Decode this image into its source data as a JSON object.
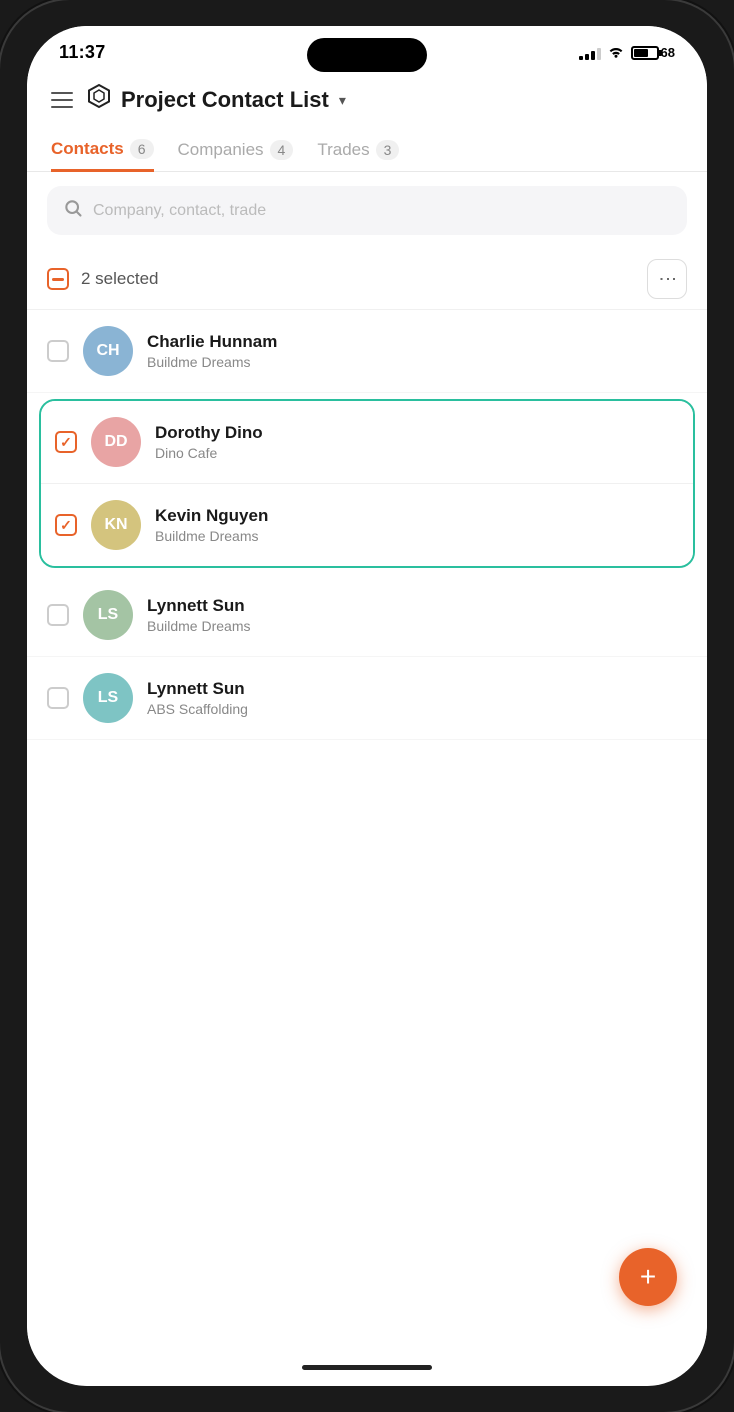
{
  "status": {
    "time": "11:37",
    "battery": "68",
    "signal_bars": [
      3,
      5,
      7,
      9,
      11
    ],
    "wifi": true
  },
  "header": {
    "menu_icon_label": "menu",
    "app_icon_label": "hexagon",
    "title": "Project Contact List",
    "chevron_label": "▾"
  },
  "tabs": [
    {
      "id": "contacts",
      "label": "Contacts",
      "count": "6",
      "active": true
    },
    {
      "id": "companies",
      "label": "Companies",
      "count": "4",
      "active": false
    },
    {
      "id": "trades",
      "label": "Trades",
      "count": "3",
      "active": false
    }
  ],
  "search": {
    "placeholder": "Company, contact, trade"
  },
  "selection": {
    "text": "2 selected",
    "partial": true
  },
  "contacts": [
    {
      "id": "ch",
      "initials": "CH",
      "avatar_color": "blue",
      "name": "Charlie Hunnam",
      "company": "Buildme Dreams",
      "checked": false
    },
    {
      "id": "dd",
      "initials": "DD",
      "avatar_color": "pink",
      "name": "Dorothy Dino",
      "company": "Dino Cafe",
      "checked": true,
      "selected_group": true
    },
    {
      "id": "kn",
      "initials": "KN",
      "avatar_color": "yellow",
      "name": "Kevin Nguyen",
      "company": "Buildme Dreams",
      "checked": true,
      "selected_group": true
    },
    {
      "id": "ls1",
      "initials": "LS",
      "avatar_color": "green",
      "name": "Lynnett Sun",
      "company": "Buildme Dreams",
      "checked": false
    },
    {
      "id": "ls2",
      "initials": "LS",
      "avatar_color": "teal",
      "name": "Lynnett Sun",
      "company": "ABS Scaffolding",
      "checked": false
    }
  ],
  "fab": {
    "label": "+"
  },
  "colors": {
    "accent": "#e8632a",
    "selected_border": "#2abf9e",
    "tab_active": "#e8632a"
  }
}
